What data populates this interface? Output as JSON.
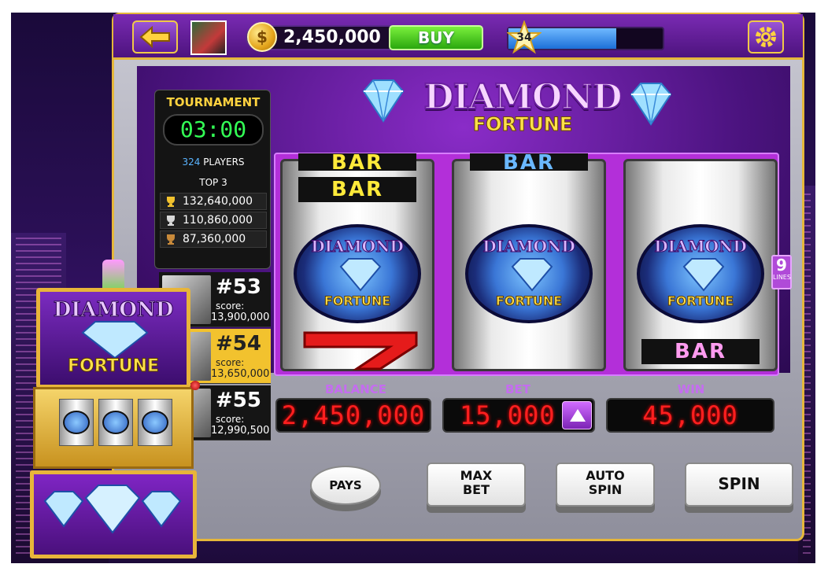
{
  "topbar": {
    "coin_glyph": "$",
    "balance": "2,450,000",
    "buy_label": "BUY",
    "level": "34",
    "xp_progress": 0.7
  },
  "title": {
    "line1": "DIAMOND",
    "line2": "FORTUNE"
  },
  "tournament": {
    "title": "TOURNAMENT",
    "timer": "03:00",
    "players_count": "324",
    "players_label": "PLAYERS",
    "top_label": "TOP 3",
    "top_scores": [
      "132,640,000",
      "110,860,000",
      "87,360,000"
    ]
  },
  "ranks": [
    {
      "rank": "#53",
      "score_label": "score:",
      "score": "13,900,000",
      "highlight": false
    },
    {
      "rank": "#54",
      "score_label": "score:",
      "score": "13,650,000",
      "highlight": true
    },
    {
      "rank": "#55",
      "score_label": "score:",
      "score": "12,990,500",
      "highlight": false
    }
  ],
  "reels": {
    "reel1": {
      "top_bar": "BAR",
      "bar2": "BAR",
      "logo_line1": "DIAMOND",
      "logo_line2": "FORTUNE"
    },
    "reel2": {
      "top_bar": "BAR",
      "logo_line1": "DIAMOND",
      "logo_line2": "FORTUNE"
    },
    "reel3": {
      "logo_line1": "DIAMOND",
      "logo_line2": "FORTUNE",
      "bottom_bar": "BAR"
    }
  },
  "lines": {
    "count": "9",
    "label": "LINES"
  },
  "meters": {
    "balance_label": "BALANCE",
    "balance_value": "2,450,000",
    "bet_label": "BET",
    "bet_value": "15,000",
    "win_label": "WIN",
    "win_value": "45,000"
  },
  "buttons": {
    "pays": "PAYS",
    "max_bet_1": "MAX",
    "max_bet_2": "BET",
    "auto_spin_1": "AUTO",
    "auto_spin_2": "SPIN",
    "spin": "SPIN"
  },
  "mini_machine": {
    "line1": "DIAMOND",
    "line2": "FORTUNE"
  },
  "colors": {
    "accent": "#7a2bb3",
    "gold": "#e5b73b",
    "meter_red": "#ff1f1f",
    "buy_green": "#2aa70e"
  }
}
